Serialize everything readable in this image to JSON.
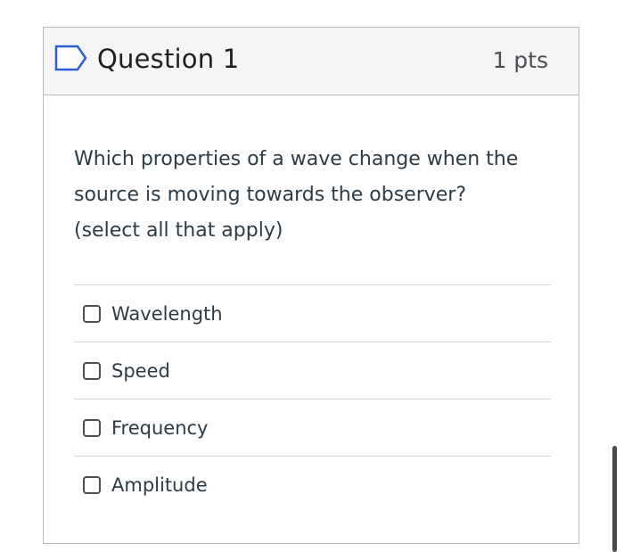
{
  "question": {
    "title": "Question 1",
    "points": "1 pts",
    "text_line1": "Which properties of a wave change when the",
    "text_line2": "source is moving towards the observer?",
    "text_line3": "(select all that apply)"
  },
  "answers": [
    {
      "label": "Wavelength",
      "checked": false
    },
    {
      "label": "Speed",
      "checked": false
    },
    {
      "label": "Frequency",
      "checked": false
    },
    {
      "label": "Amplitude",
      "checked": false
    }
  ],
  "colors": {
    "flag_stroke": "#2d5fd3",
    "border": "#b7bcc0",
    "header_bg": "#f5f5f5"
  }
}
